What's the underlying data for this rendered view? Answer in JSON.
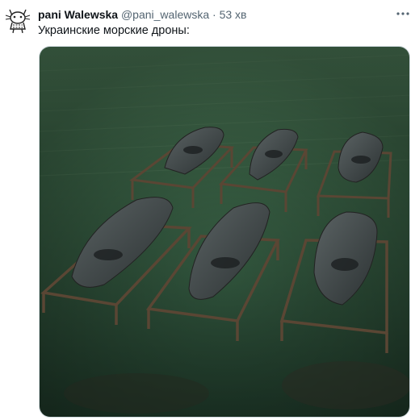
{
  "tweet": {
    "author_name": "pani Walewska",
    "handle": "@pani_walewska",
    "separator": "·",
    "time": "53 хв",
    "text": "Украинские морские дроны:",
    "avatar_icon": "cat-doodle-icon",
    "more_icon": "more-horizontal-icon",
    "media_icon": "photo-sea-drones-on-grass",
    "colors": {
      "name": "#0f1419",
      "secondary": "#536471",
      "grass_dark": "#1f3a2a",
      "grass_light": "#4d7a58",
      "boat": "#3d4445",
      "frame": "#5a4634"
    }
  }
}
